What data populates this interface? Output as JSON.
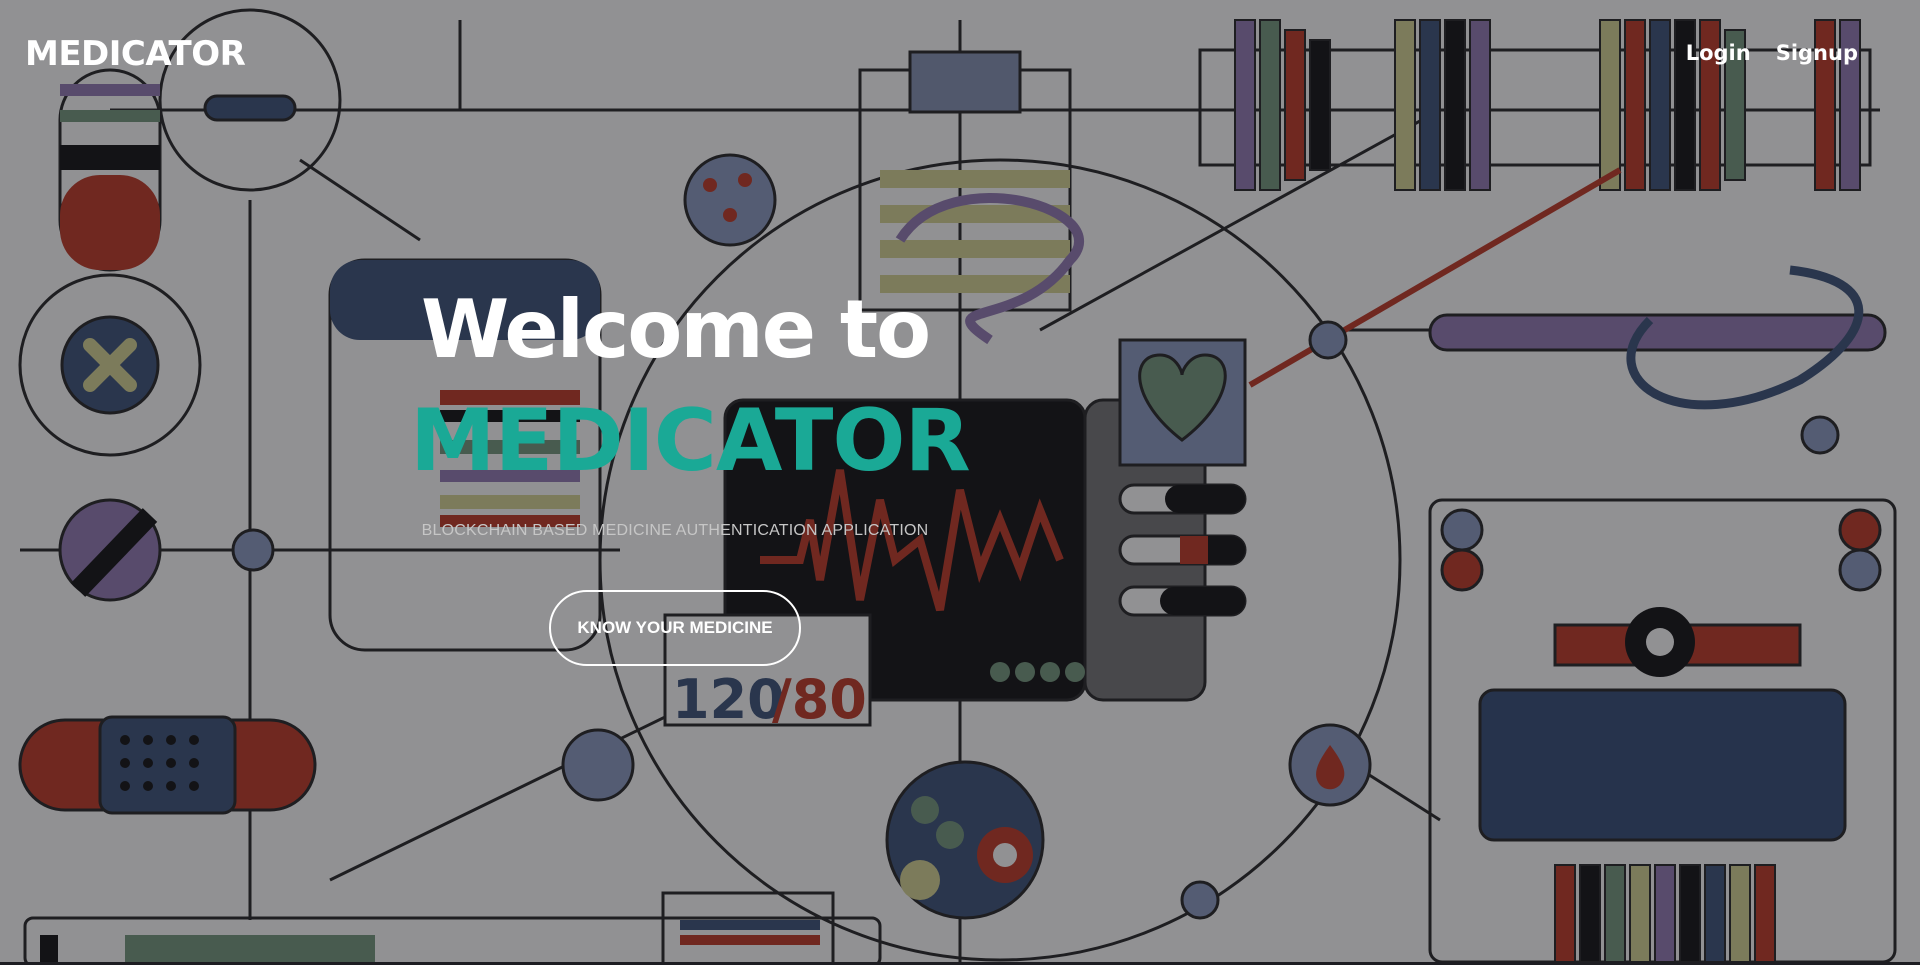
{
  "navbar": {
    "brand": "MEDICATOR",
    "links": [
      "Login",
      "Signup"
    ]
  },
  "hero": {
    "welcome": "Welcome to",
    "brand": "MEDICATOR",
    "tagline": "BLOCKCHAIN BASED MEDICINE AUTHENTICATION APPLICATION",
    "cta": "KNOW YOUR MEDICINE"
  },
  "background": {
    "illustration": "medical-line-art",
    "ecg_reading": "120/80"
  },
  "colors": {
    "accent": "#1aa996",
    "text": "#ffffff",
    "overlay": "rgba(20,20,26,0.42)"
  }
}
